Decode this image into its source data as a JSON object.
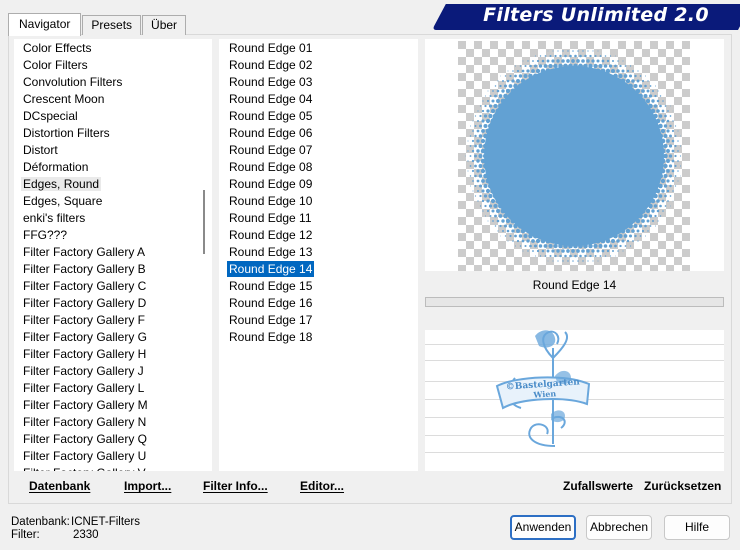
{
  "tabs": [
    {
      "label": "Navigator",
      "active": true
    },
    {
      "label": "Presets",
      "active": false
    },
    {
      "label": "Über",
      "active": false
    }
  ],
  "title": "Filters Unlimited 2.0",
  "categories": [
    "Color Effects",
    "Color Filters",
    "Convolution Filters",
    "Crescent Moon",
    "DCspecial",
    "Distortion Filters",
    "Distort",
    "Déformation",
    "Edges, Round",
    "Edges, Square",
    "enki's filters",
    "FFG???",
    "Filter Factory Gallery A",
    "Filter Factory Gallery B",
    "Filter Factory Gallery C",
    "Filter Factory Gallery D",
    "Filter Factory Gallery F",
    "Filter Factory Gallery G",
    "Filter Factory Gallery H",
    "Filter Factory Gallery J",
    "Filter Factory Gallery L",
    "Filter Factory Gallery M",
    "Filter Factory Gallery N",
    "Filter Factory Gallery Q",
    "Filter Factory Gallery U",
    "Filter Factory Gallery V"
  ],
  "selected_category": "Edges, Round",
  "filters": [
    "Round Edge 01",
    "Round Edge 02",
    "Round Edge 03",
    "Round Edge 04",
    "Round Edge 05",
    "Round Edge 06",
    "Round Edge 07",
    "Round Edge 08",
    "Round Edge 09",
    "Round Edge 10",
    "Round Edge 11",
    "Round Edge 12",
    "Round Edge 13",
    "Round Edge 14",
    "Round Edge 15",
    "Round Edge 16",
    "Round Edge 17",
    "Round Edge 18"
  ],
  "selected_filter": "Round Edge 14",
  "preview": {
    "filter_label": "Round Edge 14",
    "circle_color": "#62a1d3"
  },
  "watermark": {
    "line1": "©Bastelgarten",
    "line2": "Wien",
    "color": "#6aa7dc"
  },
  "buttons": {
    "datenbank": "Datenbank",
    "import": "Import...",
    "filter_info": "Filter Info...",
    "editor": "Editor...",
    "zufallswerte": "Zufallswerte",
    "zuruecksetzen": "Zurücksetzen",
    "anwenden": "Anwenden",
    "abbrechen": "Abbrechen",
    "hilfe": "Hilfe"
  },
  "status": {
    "database_label": "Datenbank:",
    "database_value": "ICNET-Filters",
    "filter_label": "Filter:",
    "filter_value": "2330"
  }
}
